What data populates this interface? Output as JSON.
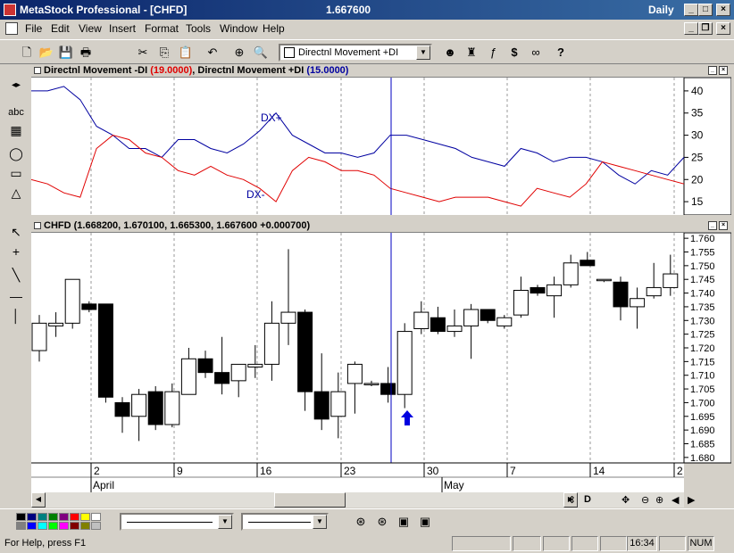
{
  "window": {
    "title": "MetaStock Professional - [CHFD]",
    "last_price": "1.667600",
    "periodicity": "Daily"
  },
  "menu": [
    "File",
    "Edit",
    "View",
    "Insert",
    "Format",
    "Tools",
    "Window",
    "Help"
  ],
  "toolbar": {
    "indicator_select": "Directnl Movement +DI"
  },
  "left_tools": [
    "abc"
  ],
  "indicator_pane": {
    "title_a": "Directnl Movement -DI",
    "param_a": "(19.0000)",
    "sep": ", ",
    "title_b": "Directnl Movement +DI",
    "param_b": "(15.0000)",
    "label_plus": "DX+",
    "label_minus": "DX-",
    "color_minus": "#e00000",
    "color_plus": "#0000a0"
  },
  "price_pane": {
    "title": "CHFD",
    "ohlc": "(1.668200, 1.670100, 1.665300, 1.667600 +0.000700)"
  },
  "x_axis": {
    "day_ticks": [
      "2",
      "9",
      "16",
      "23",
      "30",
      "7",
      "14",
      "2"
    ],
    "months": [
      "April",
      "May"
    ]
  },
  "scroll_buttons": [
    "D"
  ],
  "status": {
    "help": "For Help, press F1",
    "time": "16:34",
    "num": "NUM"
  },
  "chart_data": [
    {
      "type": "line",
      "title": "",
      "ylim": [
        12,
        43
      ],
      "yticks": [
        15,
        20,
        25,
        30,
        35,
        40
      ],
      "series": [
        {
          "name": "DX+",
          "color": "#0000a0",
          "values": [
            40,
            40,
            41,
            38,
            32,
            30,
            27,
            27,
            25,
            29,
            29,
            27,
            26,
            28,
            31,
            35,
            30,
            28,
            26,
            26,
            25,
            26,
            30,
            30,
            29,
            28,
            27,
            25,
            24,
            23,
            27,
            26,
            24,
            25,
            25,
            24,
            21,
            19,
            22,
            21,
            25
          ]
        },
        {
          "name": "DX-",
          "color": "#e00000",
          "values": [
            20,
            19,
            17,
            16,
            27,
            30,
            29,
            26,
            25,
            22,
            21,
            23,
            21,
            20,
            18,
            15,
            22,
            25,
            24,
            22,
            22,
            21,
            18,
            17,
            16,
            15,
            16,
            16,
            16,
            15,
            14,
            18,
            17,
            16,
            19,
            24,
            23,
            22,
            21,
            20,
            19
          ]
        }
      ]
    },
    {
      "type": "candlestick",
      "title": "CHFD",
      "ylim": [
        1.678,
        1.762
      ],
      "yticks": [
        "1.760",
        "1.755",
        "1.750",
        "1.745",
        "1.740",
        "1.735",
        "1.730",
        "1.725",
        "1.720",
        "1.715",
        "1.710",
        "1.705",
        "1.700",
        "1.695",
        "1.690",
        "1.685",
        "1.680"
      ],
      "candles": [
        {
          "o": 1.719,
          "h": 1.732,
          "l": 1.715,
          "c": 1.729
        },
        {
          "o": 1.728,
          "h": 1.733,
          "l": 1.724,
          "c": 1.729
        },
        {
          "o": 1.729,
          "h": 1.745,
          "l": 1.727,
          "c": 1.745
        },
        {
          "o": 1.736,
          "h": 1.737,
          "l": 1.733,
          "c": 1.734
        },
        {
          "o": 1.736,
          "h": 1.736,
          "l": 1.7,
          "c": 1.702
        },
        {
          "o": 1.7,
          "h": 1.702,
          "l": 1.689,
          "c": 1.695
        },
        {
          "o": 1.695,
          "h": 1.705,
          "l": 1.686,
          "c": 1.703
        },
        {
          "o": 1.704,
          "h": 1.706,
          "l": 1.69,
          "c": 1.692
        },
        {
          "o": 1.692,
          "h": 1.707,
          "l": 1.691,
          "c": 1.704
        },
        {
          "o": 1.703,
          "h": 1.72,
          "l": 1.703,
          "c": 1.716
        },
        {
          "o": 1.716,
          "h": 1.719,
          "l": 1.709,
          "c": 1.711
        },
        {
          "o": 1.711,
          "h": 1.724,
          "l": 1.703,
          "c": 1.707
        },
        {
          "o": 1.708,
          "h": 1.714,
          "l": 1.702,
          "c": 1.714
        },
        {
          "o": 1.713,
          "h": 1.721,
          "l": 1.709,
          "c": 1.714
        },
        {
          "o": 1.714,
          "h": 1.737,
          "l": 1.708,
          "c": 1.729
        },
        {
          "o": 1.729,
          "h": 1.756,
          "l": 1.721,
          "c": 1.733
        },
        {
          "o": 1.733,
          "h": 1.734,
          "l": 1.697,
          "c": 1.704
        },
        {
          "o": 1.704,
          "h": 1.718,
          "l": 1.69,
          "c": 1.694
        },
        {
          "o": 1.695,
          "h": 1.711,
          "l": 1.687,
          "c": 1.704
        },
        {
          "o": 1.707,
          "h": 1.715,
          "l": 1.696,
          "c": 1.714
        },
        {
          "o": 1.707,
          "h": 1.708,
          "l": 1.706,
          "c": 1.707
        },
        {
          "o": 1.707,
          "h": 1.713,
          "l": 1.7,
          "c": 1.703
        },
        {
          "o": 1.703,
          "h": 1.729,
          "l": 1.698,
          "c": 1.726
        },
        {
          "o": 1.727,
          "h": 1.737,
          "l": 1.725,
          "c": 1.733
        },
        {
          "o": 1.731,
          "h": 1.735,
          "l": 1.725,
          "c": 1.726
        },
        {
          "o": 1.726,
          "h": 1.734,
          "l": 1.724,
          "c": 1.728
        },
        {
          "o": 1.728,
          "h": 1.736,
          "l": 1.716,
          "c": 1.734
        },
        {
          "o": 1.734,
          "h": 1.734,
          "l": 1.729,
          "c": 1.73
        },
        {
          "o": 1.728,
          "h": 1.732,
          "l": 1.727,
          "c": 1.731
        },
        {
          "o": 1.732,
          "h": 1.746,
          "l": 1.731,
          "c": 1.741
        },
        {
          "o": 1.742,
          "h": 1.743,
          "l": 1.739,
          "c": 1.74
        },
        {
          "o": 1.739,
          "h": 1.746,
          "l": 1.731,
          "c": 1.743
        },
        {
          "o": 1.743,
          "h": 1.754,
          "l": 1.742,
          "c": 1.751
        },
        {
          "o": 1.752,
          "h": 1.755,
          "l": 1.75,
          "c": 1.75
        },
        {
          "o": 1.745,
          "h": 1.745,
          "l": 1.744,
          "c": 1.745
        },
        {
          "o": 1.744,
          "h": 1.746,
          "l": 1.73,
          "c": 1.735
        },
        {
          "o": 1.735,
          "h": 1.742,
          "l": 1.727,
          "c": 1.738
        },
        {
          "o": 1.739,
          "h": 1.751,
          "l": 1.738,
          "c": 1.742
        },
        {
          "o": 1.742,
          "h": 1.754,
          "l": 1.739,
          "c": 1.747
        }
      ]
    }
  ]
}
